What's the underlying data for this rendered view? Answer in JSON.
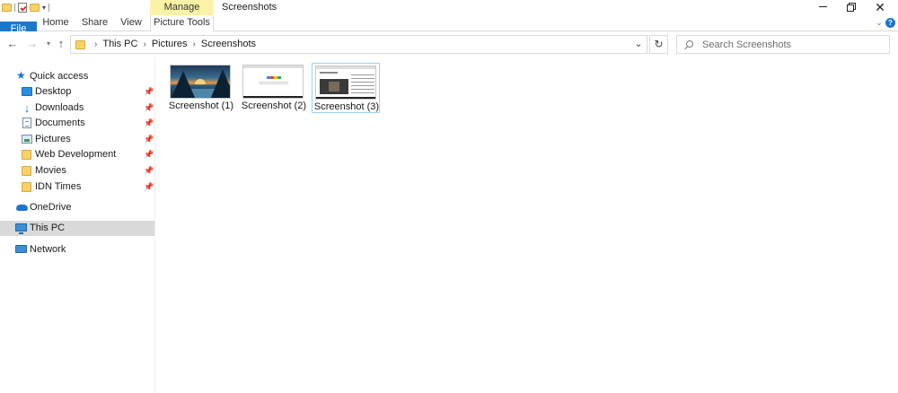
{
  "window": {
    "title": "Screenshots",
    "contextual_tab": "Manage",
    "controls": {
      "minimize": "minimize",
      "maximize": "restore",
      "close": "✕"
    }
  },
  "quick_access_toolbar": {
    "icons": [
      "folder-icon",
      "properties-icon",
      "new-folder-icon"
    ],
    "customize": "▾"
  },
  "ribbon": {
    "tabs": [
      "File",
      "Home",
      "Share",
      "View",
      "Picture Tools"
    ],
    "active_accent": "#1979ca",
    "contextual_color": "#faf3a7"
  },
  "address_bar": {
    "crumbs": [
      "This PC",
      "Pictures",
      "Screenshots"
    ],
    "separator": "›"
  },
  "search": {
    "placeholder": "Search Screenshots"
  },
  "navigation": {
    "quick_access": "Quick access",
    "pinned": [
      {
        "label": "Desktop",
        "icon": "desktop-icon"
      },
      {
        "label": "Downloads",
        "icon": "downloads-icon"
      },
      {
        "label": "Documents",
        "icon": "documents-icon"
      },
      {
        "label": "Pictures",
        "icon": "pictures-icon"
      },
      {
        "label": "Web Development",
        "icon": "folder-icon"
      },
      {
        "label": "Movies",
        "icon": "folder-icon"
      },
      {
        "label": "IDN Times",
        "icon": "folder-icon"
      }
    ],
    "onedrive": "OneDrive",
    "this_pc": "This PC",
    "network": "Network",
    "selected": "This PC"
  },
  "files": [
    {
      "name": "Screenshot (1)",
      "thumbnail": "landscape"
    },
    {
      "name": "Screenshot (2)",
      "thumbnail": "google-homepage"
    },
    {
      "name": "Screenshot (3)",
      "thumbnail": "browser-video",
      "selected": true
    }
  ]
}
